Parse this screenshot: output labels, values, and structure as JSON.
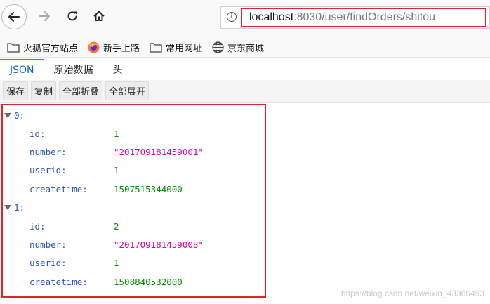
{
  "browser": {
    "url_host": "localhost",
    "url_rest": ":8030/user/findOrders/shitou"
  },
  "bookmarks": [
    {
      "label": "火狐官方站点",
      "icon": "folder-icon"
    },
    {
      "label": "新手上路",
      "icon": "firefox-icon"
    },
    {
      "label": "常用网址",
      "icon": "folder-icon"
    },
    {
      "label": "京东商城",
      "icon": "globe-icon"
    }
  ],
  "viewer": {
    "tabs": [
      "JSON",
      "原始数据",
      "头"
    ],
    "actions": [
      "保存",
      "复制",
      "全部折叠",
      "全部展开"
    ]
  },
  "json": [
    {
      "key": "0:",
      "fields": [
        {
          "k": "id:",
          "v": "1",
          "type": "num"
        },
        {
          "k": "number:",
          "v": "\"201709181459001\"",
          "type": "str"
        },
        {
          "k": "userid:",
          "v": "1",
          "type": "num"
        },
        {
          "k": "createtime:",
          "v": "1507515344000",
          "type": "num"
        }
      ]
    },
    {
      "key": "1:",
      "fields": [
        {
          "k": "id:",
          "v": "2",
          "type": "num"
        },
        {
          "k": "number:",
          "v": "\"201709181459008\"",
          "type": "str"
        },
        {
          "k": "userid:",
          "v": "1",
          "type": "num"
        },
        {
          "k": "createtime:",
          "v": "1508840532000",
          "type": "num"
        }
      ]
    }
  ],
  "watermark": "https://blog.csdn.net/weixin_43306493"
}
